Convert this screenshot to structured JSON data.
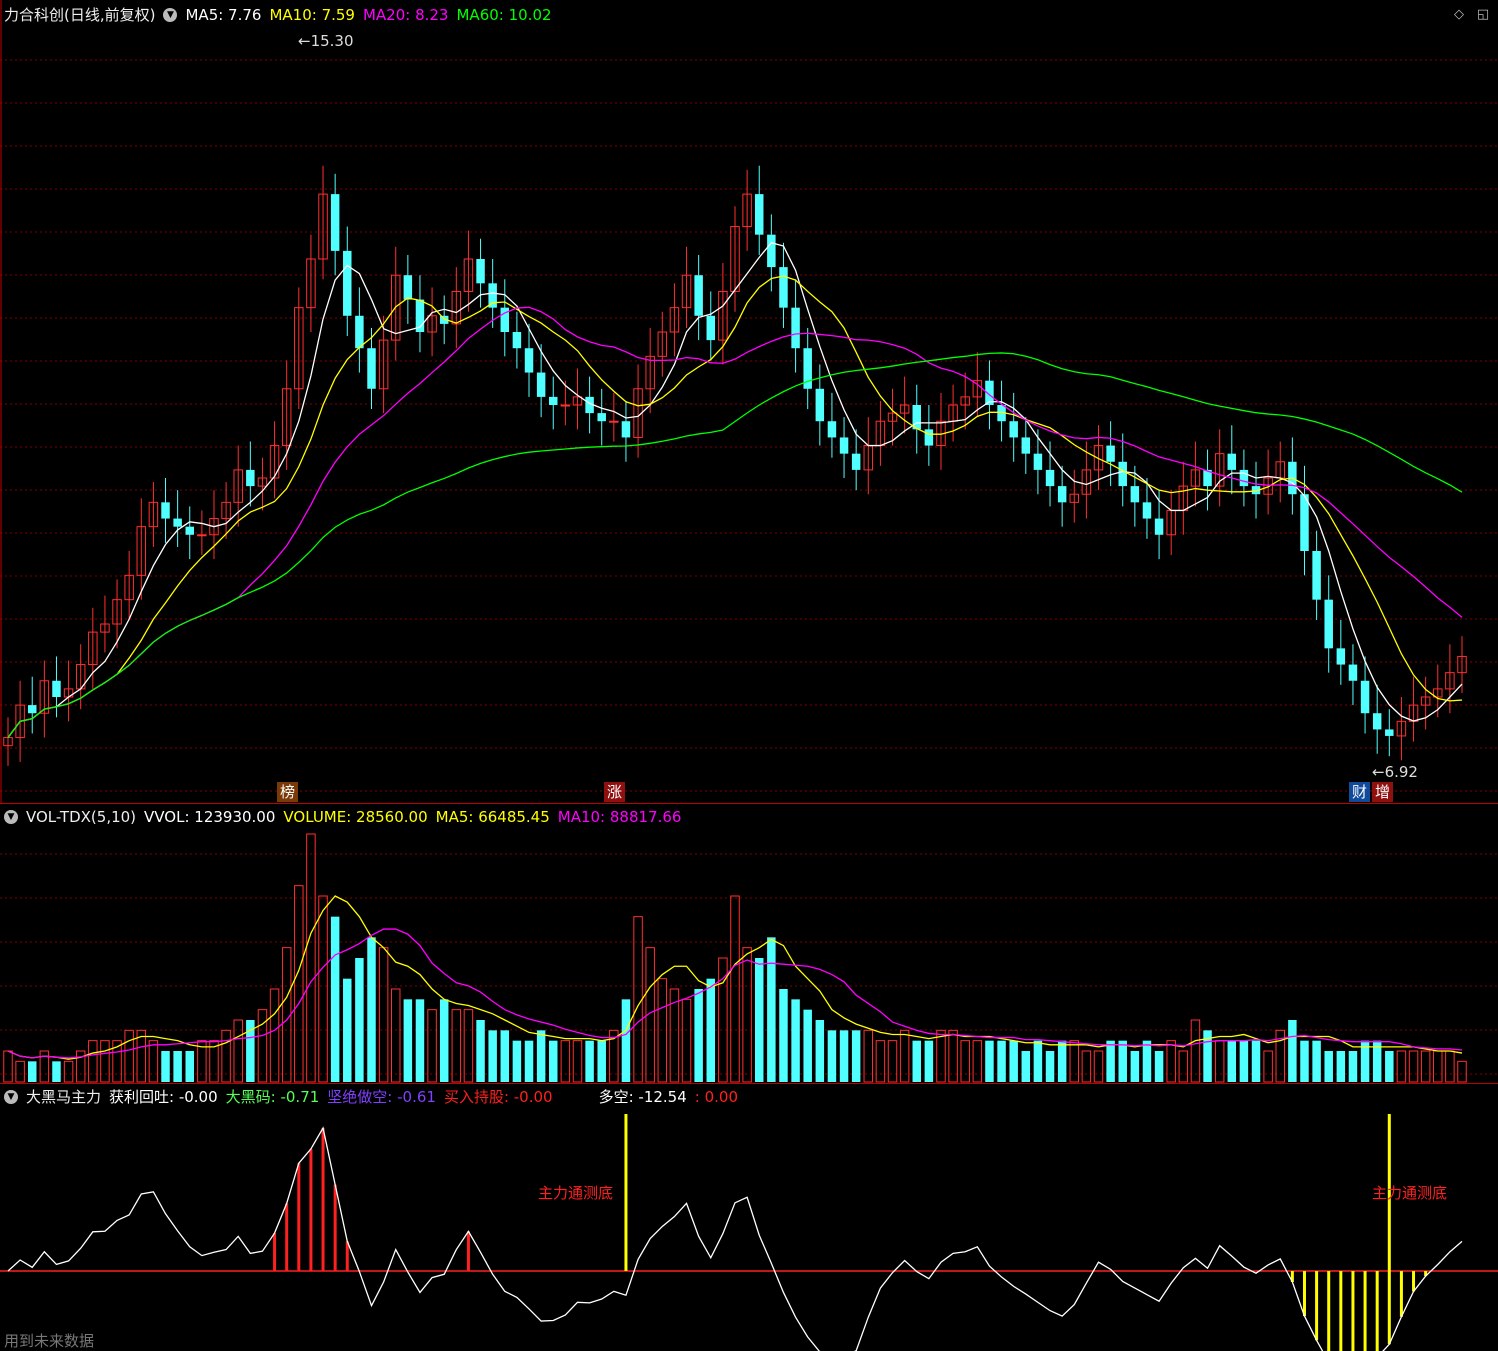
{
  "price_panel": {
    "title": "力合科创(日线,前复权)",
    "ma": [
      {
        "label": "MA5: 7.76",
        "color": "#ffffff"
      },
      {
        "label": "MA10: 7.59",
        "color": "#ffff00"
      },
      {
        "label": "MA20: 8.23",
        "color": "#ff00ff"
      },
      {
        "label": "MA60: 10.02",
        "color": "#00ff00"
      }
    ],
    "high_label": "15.30",
    "low_label": "6.92",
    "tags": [
      {
        "text": "榜",
        "color": "#a05010"
      },
      {
        "text": "涨",
        "color": "#b01010"
      },
      {
        "text": "财",
        "color": "#1050b0"
      },
      {
        "text": "增",
        "color": "#b01010"
      }
    ]
  },
  "vol_panel": {
    "name": "VOL-TDX(5,10)",
    "items": [
      {
        "label": "VVOL: 123930.00",
        "color": "#ffffff"
      },
      {
        "label": "VOLUME: 28560.00",
        "color": "#ffff00"
      },
      {
        "label": "MA5: 66485.45",
        "color": "#ffff00"
      },
      {
        "label": "MA10: 88817.66",
        "color": "#ff00ff"
      }
    ]
  },
  "ind_panel": {
    "name": "大黑马主力",
    "items": [
      {
        "label": "获利回吐: -0.00",
        "color": "#ffffff"
      },
      {
        "label": "大黑码: -0.71",
        "color": "#55ff55"
      },
      {
        "label": "坚绝做空: -0.61",
        "color": "#8040ff"
      },
      {
        "label": "买入持股: -0.00",
        "color": "#ff2020"
      },
      {
        "label": "多空: -12.54",
        "color": "#ffffff"
      },
      {
        "label": ": 0.00",
        "color": "#ff2020"
      }
    ],
    "signal_text": "主力通测底"
  },
  "footer": "用到未来数据",
  "colors": {
    "up": "#ff3030",
    "down": "#50ffff",
    "grid": "#800000",
    "frame": "#c00000"
  },
  "chart_data": {
    "type": "candlestick",
    "close": [
      6.9,
      7.3,
      7.2,
      7.6,
      7.4,
      7.5,
      7.8,
      8.2,
      8.3,
      8.6,
      8.9,
      9.5,
      9.8,
      9.6,
      9.5,
      9.4,
      9.4,
      9.6,
      9.8,
      10.2,
      10.0,
      10.1,
      10.5,
      11.2,
      12.2,
      12.8,
      13.6,
      12.9,
      12.1,
      11.7,
      11.2,
      11.8,
      12.6,
      12.3,
      11.9,
      12.1,
      12.0,
      12.4,
      12.8,
      12.5,
      12.2,
      11.9,
      11.7,
      11.4,
      11.1,
      11.0,
      11.0,
      11.1,
      10.9,
      10.8,
      10.8,
      10.6,
      11.2,
      11.6,
      11.9,
      12.2,
      12.6,
      12.1,
      11.8,
      12.4,
      13.2,
      13.6,
      13.1,
      12.7,
      12.2,
      11.7,
      11.2,
      10.8,
      10.6,
      10.4,
      10.2,
      10.5,
      10.8,
      10.9,
      11.0,
      10.7,
      10.5,
      10.8,
      11.0,
      11.1,
      11.3,
      11.0,
      10.8,
      10.6,
      10.4,
      10.2,
      10.0,
      9.8,
      9.9,
      10.2,
      10.5,
      10.3,
      10.0,
      9.8,
      9.6,
      9.4,
      9.7,
      10.0,
      10.2,
      10.0,
      10.4,
      10.2,
      10.0,
      9.9,
      10.1,
      10.3,
      9.9,
      9.2,
      8.6,
      8.0,
      7.8,
      7.6,
      7.2,
      7.0,
      6.92,
      7.1,
      7.3,
      7.4,
      7.5,
      7.7,
      7.9
    ],
    "volume": [
      3,
      2,
      2,
      3,
      2,
      2,
      3,
      4,
      4,
      4,
      5,
      5,
      4,
      3,
      3,
      3,
      4,
      4,
      5,
      6,
      6,
      7,
      9,
      13,
      19,
      24,
      18,
      16,
      10,
      12,
      14,
      13,
      9,
      8,
      8,
      7,
      8,
      7,
      7,
      6,
      5,
      5,
      4,
      4,
      5,
      4,
      4,
      4,
      4,
      4,
      5,
      8,
      16,
      13,
      10,
      9,
      8,
      9,
      10,
      12,
      18,
      13,
      12,
      14,
      9,
      8,
      7,
      6,
      5,
      5,
      5,
      5,
      4,
      4,
      5,
      4,
      4,
      5,
      5,
      4,
      4,
      4,
      4,
      4,
      3,
      4,
      3,
      4,
      4,
      3,
      3,
      4,
      4,
      3,
      4,
      3,
      4,
      3,
      6,
      5,
      4,
      4,
      4,
      4,
      3,
      5,
      6,
      4,
      4,
      3,
      3,
      3,
      4,
      4,
      3,
      3,
      3,
      3,
      3,
      3,
      2
    ],
    "ma5": [
      7.76
    ],
    "ma10": [
      7.59
    ],
    "ma20": [
      8.23
    ],
    "ma60": [
      10.02
    ],
    "ylim": [
      6.5,
      15.5
    ]
  }
}
